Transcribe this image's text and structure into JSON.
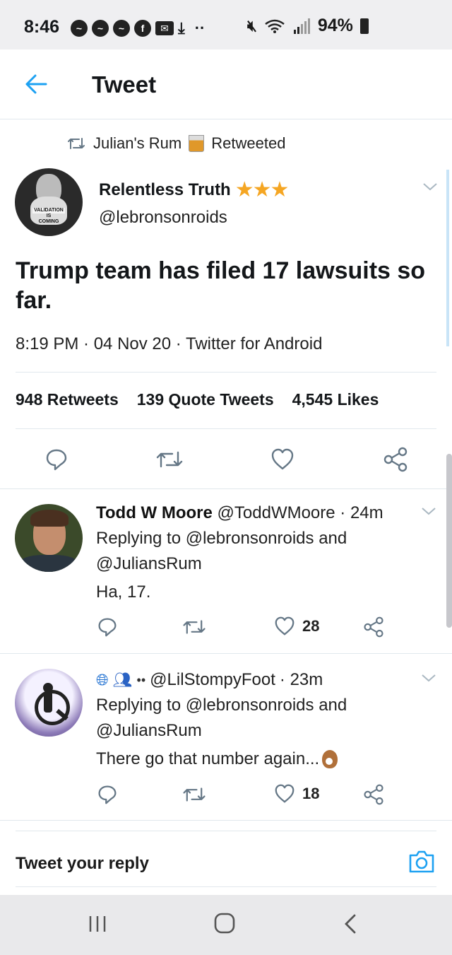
{
  "status_bar": {
    "time": "8:46",
    "battery": "94%",
    "icons": [
      "messenger-icon",
      "messenger-icon",
      "messenger-icon",
      "facebook-icon",
      "mail-icon",
      "download-icon",
      "more-dots-icon",
      "mute-icon",
      "wifi-icon",
      "signal-icon",
      "battery-icon"
    ]
  },
  "header": {
    "title": "Tweet"
  },
  "retweet_context": {
    "name": "Julian's Rum",
    "suffix": "Retweeted"
  },
  "tweet": {
    "author_name": "Relentless Truth",
    "author_handle": "@lebronsonroids",
    "avatar_text_1": "VALIDATION",
    "avatar_text_2": "IS",
    "avatar_text_3": "COMING",
    "text": "Trump team has filed 17 lawsuits so far.",
    "meta": "8:19 PM · 04 Nov 20 · Twitter for Android",
    "stats": {
      "retweets_count": "948",
      "retweets_label": "Retweets",
      "quotes_count": "139",
      "quotes_label": "Quote Tweets",
      "likes_count": "4,545",
      "likes_label": "Likes"
    }
  },
  "replies": [
    {
      "name": "Todd W Moore",
      "handle": "@ToddWMoore",
      "time": "· 24m",
      "replying_line1": "Replying to @lebronsonroids and",
      "replying_line2": "@JuliansRum",
      "text": "Ha, 17.",
      "likes": "28"
    },
    {
      "handle": "@LilStompyFoot",
      "time": "· 23m",
      "replying_line1": "Replying to @lebronsonroids and",
      "replying_line2": "@JuliansRum",
      "text": "There go that number again...",
      "likes": "18"
    }
  ],
  "composer": {
    "placeholder": "Tweet your reply"
  },
  "colors": {
    "accent": "#1da1f2",
    "star": "#f5a623",
    "icon_gray": "#657786"
  }
}
